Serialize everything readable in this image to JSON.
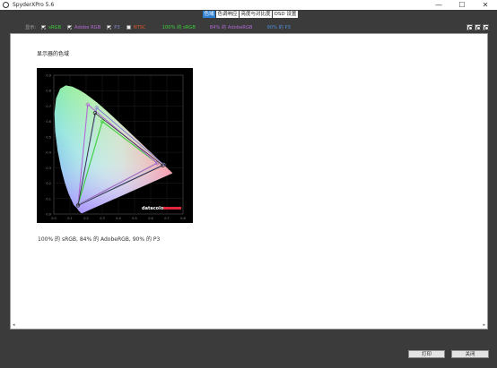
{
  "app": {
    "title": "SpyderXPro 5.6"
  },
  "window_controls": {
    "minimize": "—",
    "maximize": "☐",
    "close": "✕"
  },
  "tabs": [
    {
      "label": "色域",
      "active": true
    },
    {
      "label": "色调响应",
      "active": false
    },
    {
      "label": "亮度与对比度",
      "active": false
    },
    {
      "label": "OSD 设置",
      "active": false
    }
  ],
  "toolbar": {
    "label": "显示:",
    "gamuts": [
      {
        "label": "sRGB",
        "checked": true,
        "color": "#3ccf3c"
      },
      {
        "label": "Adobe RGB",
        "checked": true,
        "color": "#b36ad6"
      },
      {
        "label": "P3",
        "checked": true,
        "color": "#8a8ad0"
      },
      {
        "label": "NTSC",
        "checked": false,
        "color": "#d8552a"
      }
    ],
    "stats": [
      {
        "label": "100% 的 sRGB",
        "color": "#3ccf3c"
      },
      {
        "label": "84% 的 AdobeRGB",
        "color": "#b36ad6"
      },
      {
        "label": "90% 的 P3",
        "color": "#4f8fd8"
      }
    ],
    "icons": [
      "zoom-in-icon",
      "zoom-out-icon",
      "zoom-fit-icon"
    ]
  },
  "main": {
    "title": "显示器的色域",
    "result": "100% 的 sRGB, 84% 的 AdobeRGB, 90% 的 P3",
    "chart_logo": "datacolor",
    "y_ticks": [
      "0.9",
      "0.8",
      "0.7",
      "0.6",
      "0.5",
      "0.4",
      "0.3",
      "0.2",
      "0.1",
      "0.0"
    ],
    "x_ticks": [
      "0.0",
      "0.1",
      "0.2",
      "0.3",
      "0.4",
      "0.5",
      "0.6",
      "0.7",
      "0.8"
    ]
  },
  "footer": {
    "print": "打印",
    "close": "关闭"
  },
  "chart_data": {
    "type": "scatter",
    "title": "",
    "xlim": [
      0,
      0.8
    ],
    "ylim": [
      0,
      0.9
    ],
    "series": [
      {
        "name": "sRGB",
        "color": "#3ccf3c",
        "points": [
          [
            0.64,
            0.33
          ],
          [
            0.3,
            0.6
          ],
          [
            0.15,
            0.06
          ]
        ]
      },
      {
        "name": "Adobe RGB",
        "color": "#b36ad6",
        "points": [
          [
            0.64,
            0.33
          ],
          [
            0.21,
            0.71
          ],
          [
            0.15,
            0.06
          ]
        ]
      },
      {
        "name": "P3",
        "color": "#8a8ad0",
        "points": [
          [
            0.68,
            0.32
          ],
          [
            0.265,
            0.69
          ],
          [
            0.15,
            0.06
          ]
        ]
      },
      {
        "name": "Display",
        "color": "#222222",
        "points": [
          [
            0.675,
            0.315
          ],
          [
            0.255,
            0.655
          ],
          [
            0.15,
            0.055
          ]
        ]
      }
    ],
    "spectral_locus": [
      [
        0.175,
        0.005
      ],
      [
        0.172,
        0.005
      ],
      [
        0.166,
        0.009
      ],
      [
        0.155,
        0.02
      ],
      [
        0.142,
        0.04
      ],
      [
        0.124,
        0.058
      ],
      [
        0.091,
        0.133
      ],
      [
        0.069,
        0.2
      ],
      [
        0.045,
        0.295
      ],
      [
        0.023,
        0.413
      ],
      [
        0.008,
        0.538
      ],
      [
        0.004,
        0.655
      ],
      [
        0.014,
        0.75
      ],
      [
        0.039,
        0.812
      ],
      [
        0.074,
        0.834
      ],
      [
        0.114,
        0.826
      ],
      [
        0.155,
        0.806
      ],
      [
        0.193,
        0.782
      ],
      [
        0.229,
        0.754
      ],
      [
        0.266,
        0.724
      ],
      [
        0.302,
        0.692
      ],
      [
        0.337,
        0.659
      ],
      [
        0.373,
        0.625
      ],
      [
        0.408,
        0.59
      ],
      [
        0.444,
        0.555
      ],
      [
        0.479,
        0.52
      ],
      [
        0.512,
        0.487
      ],
      [
        0.545,
        0.454
      ],
      [
        0.575,
        0.424
      ],
      [
        0.603,
        0.397
      ],
      [
        0.627,
        0.373
      ],
      [
        0.648,
        0.351
      ],
      [
        0.666,
        0.334
      ],
      [
        0.68,
        0.32
      ],
      [
        0.692,
        0.308
      ],
      [
        0.735,
        0.265
      ]
    ],
    "grid": true
  }
}
